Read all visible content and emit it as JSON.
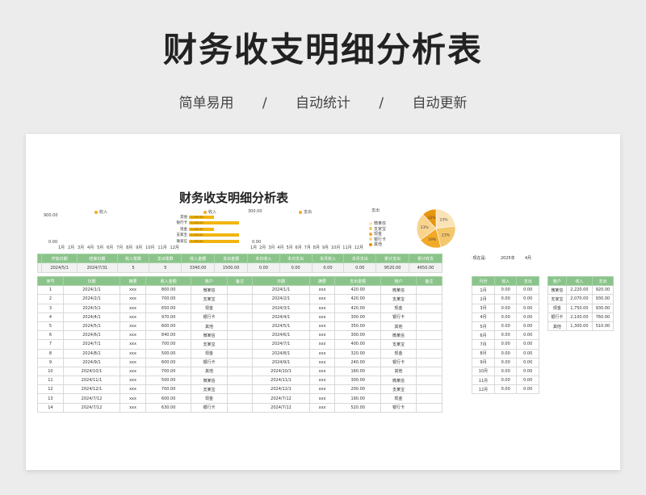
{
  "hero": {
    "title": "财务收支明细分析表",
    "tags": [
      "简单易用",
      "/",
      "自动统计",
      "/",
      "自动更新"
    ]
  },
  "sheet": {
    "title": "财务收支明细分析表",
    "chart_data": [
      {
        "type": "bar",
        "title": "",
        "legend": [
          "收入"
        ],
        "categories": [
          "1月",
          "2月",
          "3月",
          "4月",
          "5月",
          "6月",
          "7月",
          "8月",
          "9月",
          "10月",
          "11月",
          "12月"
        ],
        "y_ticks": [
          "900.00",
          "0.00"
        ],
        "series": [
          {
            "name": "收入",
            "values": [
              0,
              0,
              0,
              0,
              0,
              0,
              0,
              0,
              0,
              0,
              0,
              0
            ]
          }
        ]
      },
      {
        "type": "bar",
        "orientation": "horizontal",
        "legend": [
          "收入"
        ],
        "categories": [
          "其他",
          "银行卡",
          "现金",
          "支家宝",
          "微某信"
        ],
        "labels": [
          "1,000.00",
          "2,000.00",
          "1,000.00",
          "2,000.00",
          "2,000.00"
        ],
        "values": [
          1000,
          2000,
          1000,
          2000,
          2000
        ]
      },
      {
        "type": "bar",
        "legend": [
          "支出"
        ],
        "categories": [
          "1月",
          "2月",
          "3月",
          "4月",
          "5月",
          "6月",
          "7月",
          "8月",
          "9月",
          "10月",
          "11月",
          "12月"
        ],
        "y_ticks": [
          "300.00",
          "0.00"
        ],
        "series": [
          {
            "name": "支出",
            "values": [
              0,
              0,
              0,
              0,
              0,
              0,
              0,
              0,
              0,
              0,
              0,
              0
            ]
          }
        ]
      },
      {
        "type": "pie",
        "title": "支出",
        "categories": [
          "微某信",
          "支家宝",
          "现金",
          "银行卡",
          "其他"
        ],
        "values": [
          23,
          23,
          19,
          23,
          12
        ],
        "slice_labels": [
          "23%",
          "23%",
          "19%",
          "23%",
          "12%"
        ],
        "colors": [
          "#fbe3b8",
          "#f5c76b",
          "#f2a928",
          "#f8d48f",
          "#e9960f"
        ]
      }
    ],
    "side_info": {
      "label": "·现在是:",
      "year": "2025年",
      "month": "4月"
    },
    "summary": {
      "headers": [
        "开始日期",
        "结束日期",
        "收入笔数",
        "支出笔数",
        "收入金额",
        "支出金额",
        "本日收入",
        "本日支出",
        "本月收入",
        "本月支出",
        "累计支出",
        "累计收支"
      ],
      "values": [
        "2024/5/1",
        "2024/7/31",
        "5",
        "5",
        "3340.00",
        "1500.00",
        "0.00",
        "0.00",
        "0.00",
        "0.00",
        "9520.00",
        "4650.00"
      ]
    },
    "ledger": {
      "headers": [
        "序号",
        "日期",
        "摘要",
        "收入金额",
        "账户",
        "备注",
        "日期",
        "摘要",
        "支出金额",
        "账户",
        "备注"
      ],
      "rows": [
        [
          "1",
          "2024/1/1",
          "xxx",
          "800.00",
          "微某信",
          "",
          "2024/1/1",
          "xxx",
          "420.00",
          "微某信",
          ""
        ],
        [
          "2",
          "2024/2/1",
          "xxx",
          "700.00",
          "支某宝",
          "",
          "2024/2/1",
          "xxx",
          "420.00",
          "支某宝",
          ""
        ],
        [
          "3",
          "2024/3/1",
          "xxx",
          "650.00",
          "现金",
          "",
          "2024/3/1",
          "xxx",
          "420.00",
          "现金",
          ""
        ],
        [
          "4",
          "2024/4/1",
          "xxx",
          "970.00",
          "银行卡",
          "",
          "2024/4/1",
          "xxx",
          "300.00",
          "银行卡",
          ""
        ],
        [
          "5",
          "2024/5/1",
          "xxx",
          "600.00",
          "其他",
          "",
          "2024/5/1",
          "xxx",
          "350.00",
          "其他",
          ""
        ],
        [
          "6",
          "2024/6/1",
          "xxx",
          "840.00",
          "微某信",
          "",
          "2024/6/1",
          "xxx",
          "300.00",
          "微某信",
          ""
        ],
        [
          "7",
          "2024/7/1",
          "xxx",
          "700.00",
          "支某宝",
          "",
          "2024/7/1",
          "xxx",
          "400.00",
          "支某宝",
          ""
        ],
        [
          "8",
          "2024/8/1",
          "xxx",
          "500.00",
          "现金",
          "",
          "2024/8/1",
          "xxx",
          "320.00",
          "现金",
          ""
        ],
        [
          "9",
          "2024/9/1",
          "xxx",
          "600.00",
          "银行卡",
          "",
          "2024/9/1",
          "xxx",
          "240.00",
          "银行卡",
          ""
        ],
        [
          "10",
          "2024/10/1",
          "xxx",
          "700.00",
          "其他",
          "",
          "2024/10/1",
          "xxx",
          "160.00",
          "其他",
          ""
        ],
        [
          "11",
          "2024/11/1",
          "xxx",
          "500.00",
          "微某信",
          "",
          "2024/11/1",
          "xxx",
          "300.00",
          "微某信",
          ""
        ],
        [
          "12",
          "2024/12/1",
          "xxx",
          "700.00",
          "支某宝",
          "",
          "2024/12/1",
          "xxx",
          "200.00",
          "支某宝",
          ""
        ],
        [
          "13",
          "2024/7/12",
          "xxx",
          "600.00",
          "现金",
          "",
          "2024/7/12",
          "xxx",
          "190.00",
          "现金",
          ""
        ],
        [
          "14",
          "2024/7/12",
          "xxx",
          "630.00",
          "银行卡",
          "",
          "2024/7/12",
          "xxx",
          "520.00",
          "银行卡",
          ""
        ]
      ]
    },
    "monthly": {
      "headers": [
        "月份",
        "收入",
        "支出"
      ],
      "rows": [
        [
          "1月",
          "0.00",
          "0.00"
        ],
        [
          "2月",
          "0.00",
          "0.00"
        ],
        [
          "3月",
          "0.00",
          "0.00"
        ],
        [
          "4月",
          "0.00",
          "0.00"
        ],
        [
          "5月",
          "0.00",
          "0.00"
        ],
        [
          "6月",
          "0.00",
          "0.00"
        ],
        [
          "7月",
          "0.00",
          "0.00"
        ],
        [
          "8月",
          "0.00",
          "0.00"
        ],
        [
          "9月",
          "0.00",
          "0.00"
        ],
        [
          "10月",
          "0.00",
          "0.00"
        ],
        [
          "11月",
          "0.00",
          "0.00"
        ],
        [
          "12月",
          "0.00",
          "0.00"
        ]
      ]
    },
    "accounts": {
      "headers": [
        "账户",
        "收入",
        "支出"
      ],
      "rows": [
        [
          "微某信",
          "2,220.00",
          "920.00"
        ],
        [
          "支家宝",
          "2,070.00",
          "930.00"
        ],
        [
          "现金",
          "1,750.00",
          "930.00"
        ],
        [
          "银行卡",
          "2,100.00",
          "760.00"
        ],
        [
          "其他",
          "1,300.00",
          "510.00"
        ]
      ]
    }
  }
}
